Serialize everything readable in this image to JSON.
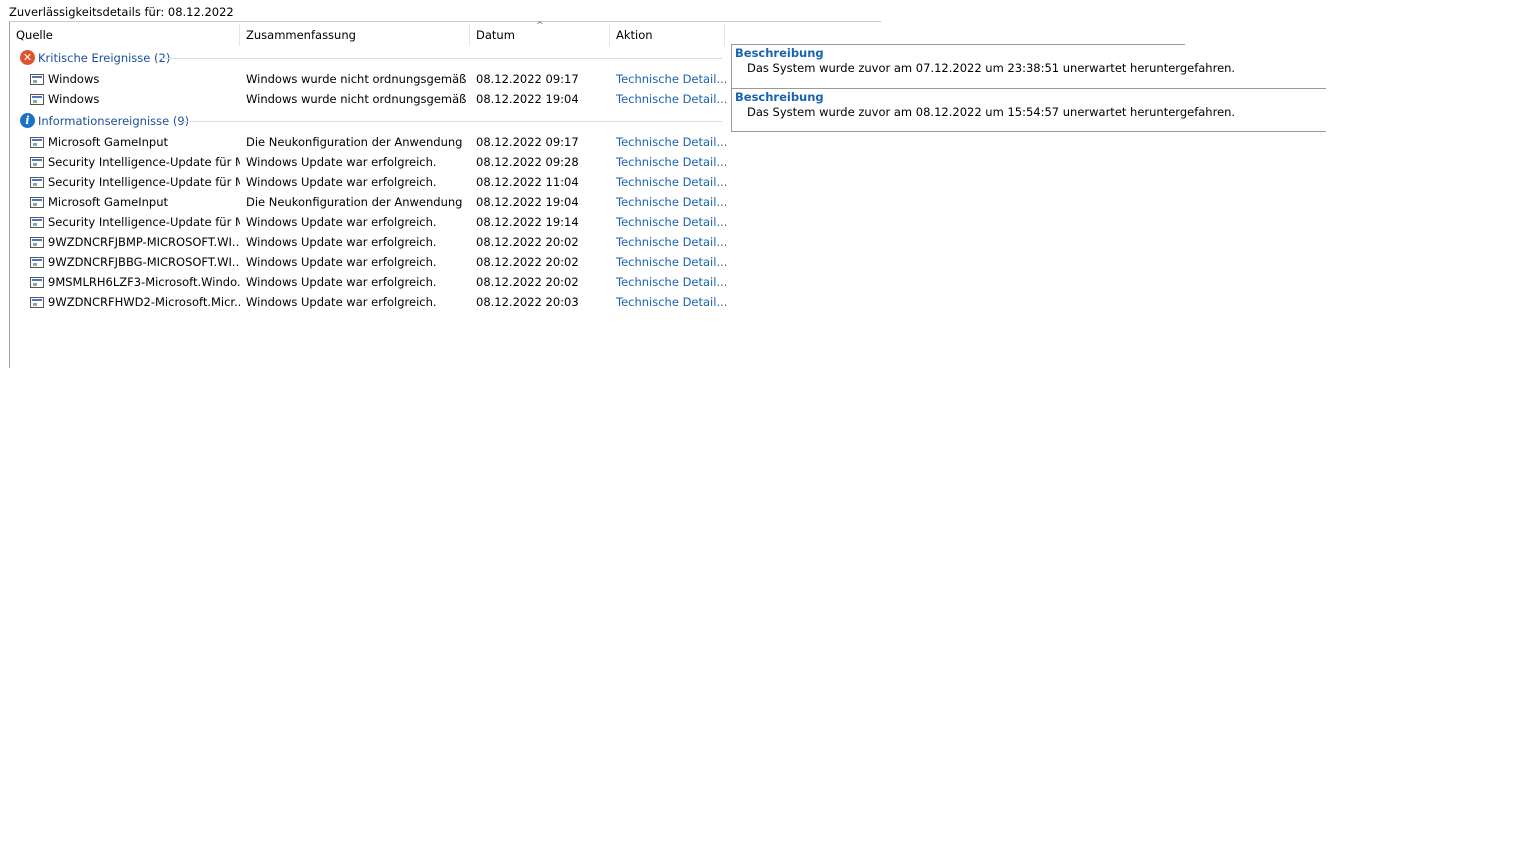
{
  "title": "Zuverlässigkeitsdetails für: 08.12.2022",
  "columns": {
    "source": "Quelle",
    "summary": "Zusammenfassung",
    "date": "Datum",
    "action": "Aktion"
  },
  "groups": [
    {
      "label": "Kritische Ereignisse (2)",
      "icon": "error-icon",
      "rows": [
        {
          "source": "Windows",
          "summary": "Windows wurde nicht ordnungsgemäß ...",
          "date": "08.12.2022 09:17",
          "action": "Technische Detail..."
        },
        {
          "source": "Windows",
          "summary": "Windows wurde nicht ordnungsgemäß ...",
          "date": "08.12.2022 19:04",
          "action": "Technische Detail..."
        }
      ]
    },
    {
      "label": "Informationsereignisse (9)",
      "icon": "info-icon",
      "rows": [
        {
          "source": "Microsoft GameInput",
          "summary": "Die Neukonfiguration der Anwendung ...",
          "date": "08.12.2022 09:17",
          "action": "Technische Detail..."
        },
        {
          "source": "Security Intelligence-Update für M...",
          "summary": "Windows Update war erfolgreich.",
          "date": "08.12.2022 09:28",
          "action": "Technische Detail..."
        },
        {
          "source": "Security Intelligence-Update für M...",
          "summary": "Windows Update war erfolgreich.",
          "date": "08.12.2022 11:04",
          "action": "Technische Detail..."
        },
        {
          "source": "Microsoft GameInput",
          "summary": "Die Neukonfiguration der Anwendung ...",
          "date": "08.12.2022 19:04",
          "action": "Technische Detail..."
        },
        {
          "source": "Security Intelligence-Update für M...",
          "summary": "Windows Update war erfolgreich.",
          "date": "08.12.2022 19:14",
          "action": "Technische Detail..."
        },
        {
          "source": "9WZDNCRFJBMP-MICROSOFT.WI...",
          "summary": "Windows Update war erfolgreich.",
          "date": "08.12.2022 20:02",
          "action": "Technische Detail..."
        },
        {
          "source": "9WZDNCRFJBBG-MICROSOFT.WI...",
          "summary": "Windows Update war erfolgreich.",
          "date": "08.12.2022 20:02",
          "action": "Technische Detail..."
        },
        {
          "source": "9MSMLRH6LZF3-Microsoft.Windo...",
          "summary": "Windows Update war erfolgreich.",
          "date": "08.12.2022 20:02",
          "action": "Technische Detail..."
        },
        {
          "source": "9WZDNCRFHWD2-Microsoft.Micr...",
          "summary": "Windows Update war erfolgreich.",
          "date": "08.12.2022 20:03",
          "action": "Technische Detail..."
        }
      ]
    }
  ],
  "details": [
    {
      "heading": "Beschreibung",
      "text": "Das System wurde zuvor am 07.12.2022 um 23:38:51 unerwartet heruntergefahren."
    },
    {
      "heading": "Beschreibung",
      "text": "Das System wurde zuvor am 08.12.2022 um 15:54:57 unerwartet heruntergefahren."
    }
  ],
  "colors": {
    "link": "#1a63b0",
    "group_label": "#1b4f9c",
    "error": "#e0522e",
    "info": "#1a73c9"
  }
}
